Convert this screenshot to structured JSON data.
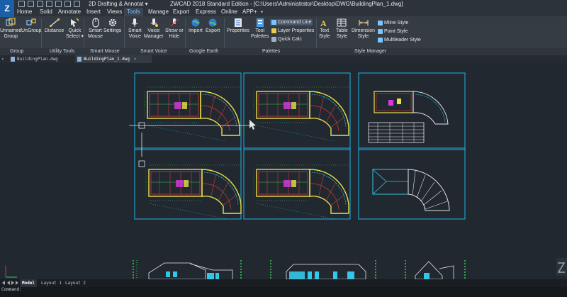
{
  "app": {
    "logo_letter": "Z",
    "workspace_label": "2D Drafting & Annotat ▾",
    "window_title": "ZWCAD 2018 Standard Edition - [C:\\Users\\Administrator\\Desktop\\DWG\\BuildingPlan_1.dwg]"
  },
  "menu_tabs": [
    "Home",
    "Solid",
    "Annotate",
    "Insert",
    "Views",
    "Tools",
    "Manage",
    "Export",
    "Express",
    "Online",
    "APP+",
    "▪"
  ],
  "active_tab": "Tools",
  "ribbon": {
    "group_panel": {
      "ungroup_top": "Unnamed",
      "ungroup_bottom": "Group",
      "ungroup2": "UnGroup"
    },
    "distance": "Distance",
    "quick_select_top": "Quick",
    "quick_select_bottom": "Select ▾",
    "smart_mouse_top": "Smart",
    "smart_mouse_bottom": "Mouse",
    "settings": "Settings",
    "smart_voice_top": "Smart",
    "smart_voice_bottom": "Voice",
    "voice_manager_top": "Voice",
    "voice_manager_bottom": "Manager",
    "show_hide_top": "Show or",
    "show_hide_bottom": "Hide",
    "import": "Import",
    "export": "Export",
    "properties": "Properties",
    "tool_palettes_top": "Tool",
    "tool_palettes_bottom": "Palettes",
    "command_line": "Command Line",
    "layer_properties": "Layer Properties",
    "quick_calc": "Quick Calc",
    "text_style_top": "Text",
    "text_style_bottom": "Style",
    "table_style_top": "Table",
    "table_style_bottom": "Style",
    "dimension_style_top": "Dimension",
    "dimension_style_bottom": "Style",
    "mline_style": "Mline Style",
    "point_style": "Point Style",
    "multileader_style": "Multileader Style"
  },
  "ribbon_groups": [
    "Group",
    "Utility Tools",
    "Smart Mouse",
    "Smart Voice",
    "Google Earth",
    "Palettes",
    "Style Manager"
  ],
  "doc_tabs": [
    {
      "name": "BuildingPlan.dwg",
      "close": ""
    },
    {
      "name": "BuildingPlan_1.dwg",
      "close": "×"
    }
  ],
  "layout_tabs": [
    "Model",
    "Layout 1",
    "Layout 2"
  ],
  "active_layout": "Model",
  "command_line": {
    "history": "",
    "prompt": "Command:"
  },
  "colors": {
    "accent": "#7cc4ff",
    "viewport_frame": "#1fb4e6",
    "plan_yellow": "#e8e04a",
    "plan_red": "#d8383a",
    "plan_cyan": "#34c6e8",
    "plan_magenta": "#d83adf",
    "plan_green": "#35d049"
  },
  "icons": [
    "group-icon",
    "ungroup-icon",
    "distance-icon",
    "quick-select-icon",
    "mouse-icon",
    "gear-icon",
    "microphone-icon",
    "voice-manager-icon",
    "show-hide-icon",
    "import-icon",
    "export-icon",
    "properties-icon",
    "palettes-icon",
    "text-style-icon",
    "table-style-icon",
    "dimension-style-icon"
  ]
}
